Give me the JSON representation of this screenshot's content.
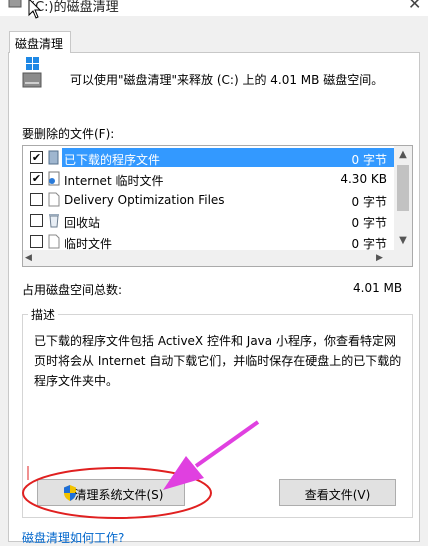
{
  "window": {
    "title": "(C:)的磁盘清理",
    "close_glyph": "✕"
  },
  "tab": {
    "label": "磁盘清理"
  },
  "summary": "可以使用\"磁盘清理\"来释放  (C:) 上的 4.01 MB 磁盘空间。",
  "files_to_delete_label": "要删除的文件(F):",
  "files": [
    {
      "name": "已下载的程序文件",
      "size": "0 字节",
      "checked": true,
      "selected": true,
      "icon": "folder-icon"
    },
    {
      "name": "Internet 临时文件",
      "size": "4.30 KB",
      "checked": true,
      "selected": false,
      "icon": "internet-files-icon"
    },
    {
      "name": "Delivery Optimization Files",
      "size": "0 字节",
      "checked": false,
      "selected": false,
      "icon": "file-icon"
    },
    {
      "name": "回收站",
      "size": "0 字节",
      "checked": false,
      "selected": false,
      "icon": "recycle-bin-icon"
    },
    {
      "name": "临时文件",
      "size": "0 字节",
      "checked": false,
      "selected": false,
      "icon": "file-icon"
    }
  ],
  "total": {
    "label": "占用磁盘空间总数:",
    "value": "4.01 MB"
  },
  "description": {
    "legend": "描述",
    "text": "已下载的程序文件包括 ActiveX 控件和 Java 小程序，你查看特定网页时将会从 Internet 自动下载它们，并临时保存在硬盘上的已下载的程序文件夹中。"
  },
  "buttons": {
    "clean_system": "清理系统文件(S)",
    "view_files": "查看文件(V)"
  },
  "bottom_link": "磁盘清理如何工作?",
  "colors": {
    "selection": "#3399ff",
    "annotation": "#e040e0",
    "highlight_ellipse": "#e02020",
    "link": "#0066cc"
  }
}
